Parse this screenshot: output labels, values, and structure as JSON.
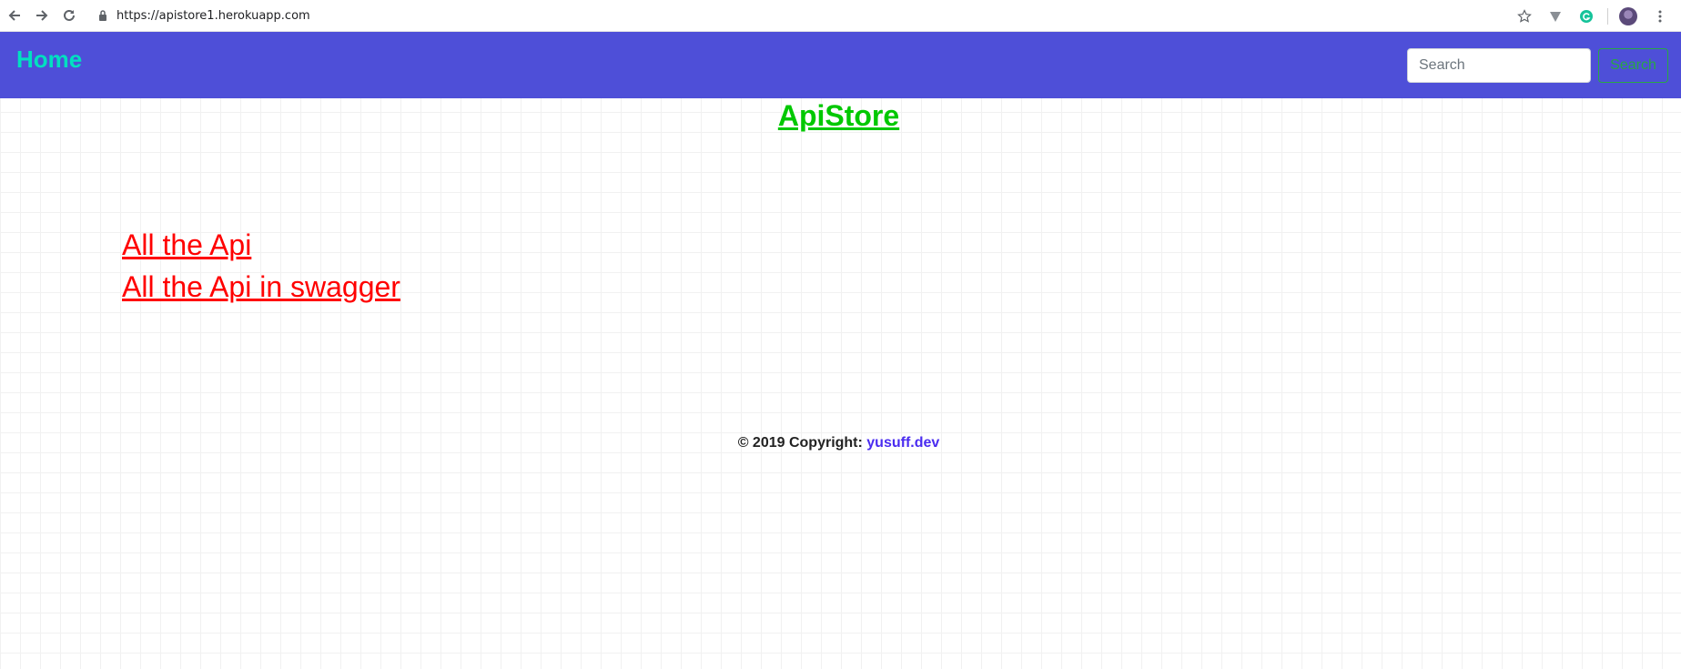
{
  "browser": {
    "url": "https://apistore1.herokuapp.com"
  },
  "navbar": {
    "brand": "Home",
    "search_placeholder": "Search",
    "search_button": "Search"
  },
  "main": {
    "title": "ApiStore",
    "links": [
      {
        "label": "All the Api"
      },
      {
        "label": "All the Api in swagger"
      }
    ]
  },
  "footer": {
    "copyright": "© 2019 Copyright: ",
    "link": "yusuff.dev"
  },
  "colors": {
    "navbar_bg": "#4e4fd8",
    "brand": "#00e0c0",
    "title": "#00c800",
    "links": "#ff0000",
    "search_button": "#28a745",
    "footer_link": "#4a2cf0"
  }
}
